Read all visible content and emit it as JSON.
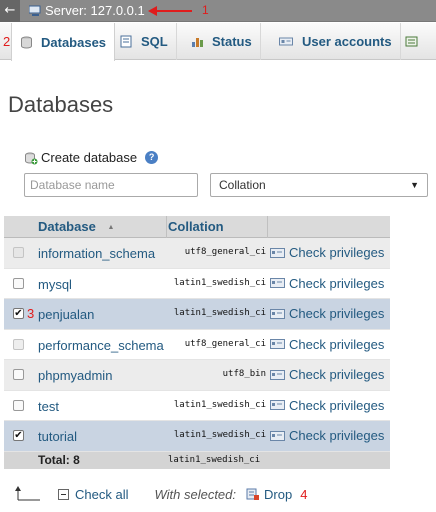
{
  "topbar": {
    "back_glyph": "←",
    "server_label": "Server: 127.0.0.1",
    "annotation": "1",
    "server_icon": "server-icon"
  },
  "tabs": [
    {
      "label": "Databases",
      "icon": "databases-icon",
      "active": true
    },
    {
      "label": "SQL",
      "icon": "sql-icon",
      "active": false
    },
    {
      "label": "Status",
      "icon": "status-icon",
      "active": false
    },
    {
      "label": "User accounts",
      "icon": "user-accounts-icon",
      "active": false
    }
  ],
  "tab_annotation": "2",
  "page_title": "Databases",
  "create": {
    "label": "Create database",
    "name_placeholder": "Database name",
    "collation_label": "Collation",
    "help_glyph": "?"
  },
  "table": {
    "col_database": "Database",
    "col_collation": "Collation",
    "sort_glyph": "▲",
    "rows": [
      {
        "name": "information_schema",
        "collation": "utf8_general_ci",
        "action": "Check privileges",
        "checked": false,
        "disabled": true,
        "marked": false
      },
      {
        "name": "mysql",
        "collation": "latin1_swedish_ci",
        "action": "Check privileges",
        "checked": false,
        "disabled": false,
        "marked": false
      },
      {
        "name": "penjualan",
        "collation": "latin1_swedish_ci",
        "action": "Check privileges",
        "checked": true,
        "disabled": false,
        "marked": true,
        "annotation": "3"
      },
      {
        "name": "performance_schema",
        "collation": "utf8_general_ci",
        "action": "Check privileges",
        "checked": false,
        "disabled": true,
        "marked": false
      },
      {
        "name": "phpmyadmin",
        "collation": "utf8_bin",
        "action": "Check privileges",
        "checked": false,
        "disabled": false,
        "marked": false
      },
      {
        "name": "test",
        "collation": "latin1_swedish_ci",
        "action": "Check privileges",
        "checked": false,
        "disabled": false,
        "marked": false
      },
      {
        "name": "tutorial",
        "collation": "latin1_swedish_ci",
        "action": "Check privileges",
        "checked": true,
        "disabled": false,
        "marked": true
      }
    ],
    "total_label": "Total: 8",
    "total_collation": "latin1_swedish_ci"
  },
  "footer": {
    "check_all": "Check all",
    "with_selected": "With selected:",
    "drop": "Drop",
    "annotation": "4"
  },
  "colors": {
    "link": "#235a81",
    "annotation": "#e01c1c",
    "marked_row": "#c9d4e2",
    "topbar": "#8a8a8a"
  }
}
